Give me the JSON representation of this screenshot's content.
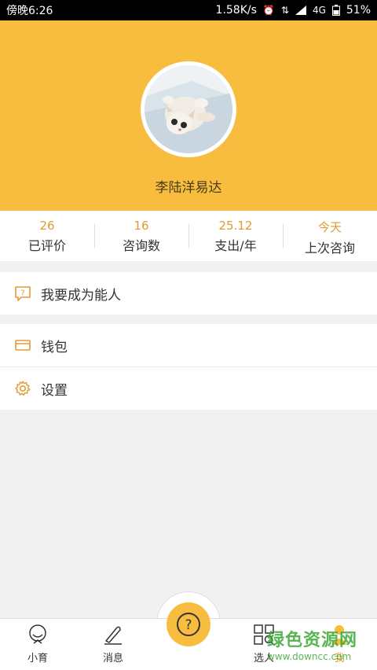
{
  "status_bar": {
    "time": "傍晚6:26",
    "network_speed": "1.58K/s",
    "network_type": "4G",
    "battery": "51%"
  },
  "profile": {
    "username": "李陆洋易达"
  },
  "stats": [
    {
      "value": "26",
      "label": "已评价"
    },
    {
      "value": "16",
      "label": "咨询数"
    },
    {
      "value": "25.12",
      "label": "支出/年"
    },
    {
      "value": "今天",
      "label": "上次咨询"
    }
  ],
  "menu": {
    "become_expert": "我要成为能人",
    "wallet": "钱包",
    "settings": "设置"
  },
  "tabbar": {
    "tabs": [
      {
        "label": "小育"
      },
      {
        "label": "消息"
      },
      {
        "label": "选人"
      },
      {
        "label": "我"
      }
    ]
  },
  "watermark": {
    "title": "绿色资源网",
    "url": "www.downcc.com"
  },
  "colors": {
    "accent": "#f8bd3f",
    "stat_value": "#e39a32",
    "watermark": "#3aaa35"
  }
}
